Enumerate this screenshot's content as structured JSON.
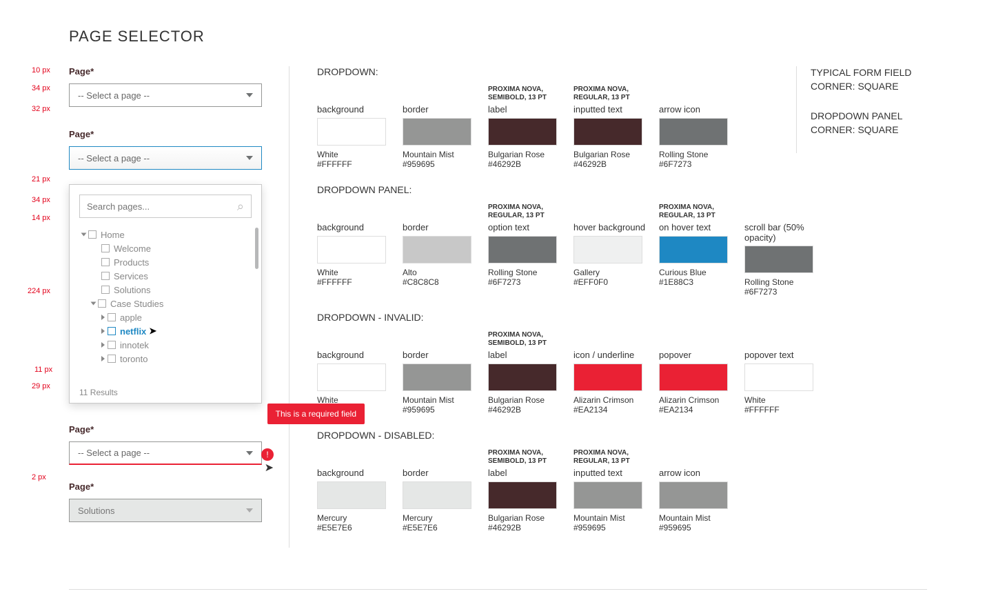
{
  "page_title": "PAGE SELECTOR",
  "field": {
    "label": "Page*",
    "placeholder": "-- Select a page --",
    "search_placeholder": "Search pages...",
    "results_text": "11 Results",
    "disabled_value": "Solutions",
    "error_text": "This is a required field"
  },
  "tree": {
    "home": "Home",
    "welcome": "Welcome",
    "products": "Products",
    "services": "Services",
    "solutions": "Solutions",
    "case_studies": "Case Studies",
    "apple": "apple",
    "netflix": "netflix",
    "innotek": "innotek",
    "toronto": "toronto"
  },
  "dims": {
    "d10": "10 px",
    "d34a": "34 px",
    "d32": "32 px",
    "d21": "21 px",
    "d34b": "34 px",
    "d14": "14 px",
    "d224": "224 px",
    "d11": "11 px",
    "d29": "29 px",
    "d2": "2 px"
  },
  "labels": {
    "dropdown": "DROPDOWN:",
    "dropdown_panel": "DROPDOWN PANEL:",
    "dropdown_invalid": "DROPDOWN - INVALID:",
    "dropdown_disabled": "DROPDOWN - DISABLED:",
    "background": "background",
    "border": "border",
    "label": "label",
    "inputted_text": "inputted text",
    "arrow_icon": "arrow icon",
    "option_text": "option text",
    "hover_bg": "hover background",
    "on_hover_text": "on hover text",
    "scroll_bar": "scroll bar (50% opacity)",
    "icon_underline": "icon / underline",
    "popover": "popover",
    "popover_text": "popover text",
    "font_semi": "PROXIMA NOVA, SEMIBOLD, 13 PT",
    "font_reg": "PROXIMA NOVA, REGULAR, 13 PT"
  },
  "colors": {
    "white": {
      "name": "White",
      "hex": "#FFFFFF"
    },
    "mountain_mist": {
      "name": "Mountain Mist",
      "hex": "#959695"
    },
    "bulgarian_rose": {
      "name": "Bulgarian Rose",
      "hex": "#46292B"
    },
    "rolling_stone": {
      "name": "Rolling Stone",
      "hex": "#6F7273"
    },
    "alto": {
      "name": "Alto",
      "hex": "#C8C8C8"
    },
    "gallery": {
      "name": "Gallery",
      "hex": "#EFF0F0"
    },
    "curious_blue": {
      "name": "Curious Blue",
      "hex": "#1E88C3"
    },
    "alizarin_crimson": {
      "name": "Alizarin Crimson",
      "hex": "#EA2134"
    },
    "mercury": {
      "name": "Mercury",
      "hex": "#E5E7E6"
    }
  },
  "notes": {
    "n1": "TYPICAL FORM FIELD CORNER:  SQUARE",
    "n2": "DROPDOWN PANEL CORNER:  SQUARE"
  }
}
